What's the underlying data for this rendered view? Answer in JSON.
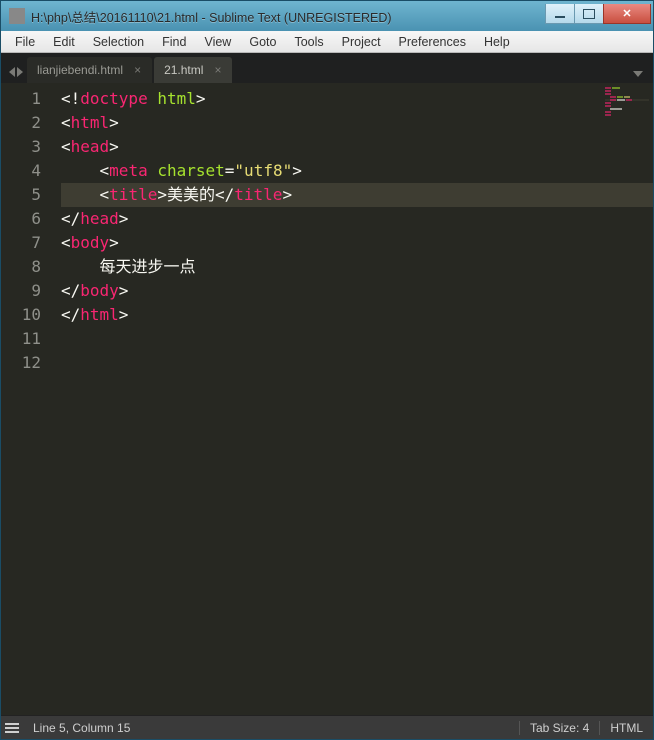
{
  "window": {
    "title": "H:\\php\\总结\\20161110\\21.html - Sublime Text (UNREGISTERED)"
  },
  "menu": {
    "items": [
      "File",
      "Edit",
      "Selection",
      "Find",
      "View",
      "Goto",
      "Tools",
      "Project",
      "Preferences",
      "Help"
    ]
  },
  "tabs": [
    {
      "label": "lianjiebendi.html",
      "active": false
    },
    {
      "label": "21.html",
      "active": true
    }
  ],
  "code": {
    "lines": [
      {
        "n": 1,
        "tokens": [
          [
            "<!",
            "punct"
          ],
          [
            "doctype",
            "tag"
          ],
          [
            " ",
            "punct"
          ],
          [
            "html",
            "attr"
          ],
          [
            ">",
            "punct"
          ]
        ]
      },
      {
        "n": 2,
        "tokens": [
          [
            "<",
            "punct"
          ],
          [
            "html",
            "tag"
          ],
          [
            ">",
            "punct"
          ]
        ]
      },
      {
        "n": 3,
        "tokens": [
          [
            "<",
            "punct"
          ],
          [
            "head",
            "tag"
          ],
          [
            ">",
            "punct"
          ]
        ]
      },
      {
        "n": 4,
        "tokens": [
          [
            "    <",
            "punct"
          ],
          [
            "meta",
            "tag"
          ],
          [
            " ",
            "punct"
          ],
          [
            "charset",
            "attr"
          ],
          [
            "=",
            "punct"
          ],
          [
            "\"utf8\"",
            "str"
          ],
          [
            ">",
            "punct"
          ]
        ]
      },
      {
        "n": 5,
        "hl": true,
        "tokens": [
          [
            "    <",
            "punct"
          ],
          [
            "title",
            "tag"
          ],
          [
            ">",
            "punct"
          ],
          [
            "美美的",
            "text"
          ],
          [
            "</",
            "punct"
          ],
          [
            "title",
            "tag"
          ],
          [
            ">",
            "punct"
          ]
        ]
      },
      {
        "n": 6,
        "tokens": [
          [
            "</",
            "punct"
          ],
          [
            "head",
            "tag"
          ],
          [
            ">",
            "punct"
          ]
        ]
      },
      {
        "n": 7,
        "tokens": [
          [
            "<",
            "punct"
          ],
          [
            "body",
            "tag"
          ],
          [
            ">",
            "punct"
          ]
        ]
      },
      {
        "n": 8,
        "tokens": [
          [
            "    每天进步一点",
            "text"
          ]
        ]
      },
      {
        "n": 9,
        "tokens": [
          [
            "</",
            "punct"
          ],
          [
            "body",
            "tag"
          ],
          [
            ">",
            "punct"
          ]
        ]
      },
      {
        "n": 10,
        "tokens": [
          [
            "</",
            "punct"
          ],
          [
            "html",
            "tag"
          ],
          [
            ">",
            "punct"
          ]
        ]
      },
      {
        "n": 11,
        "tokens": []
      },
      {
        "n": 12,
        "tokens": []
      }
    ]
  },
  "status": {
    "cursor": "Line 5, Column 15",
    "tabsize": "Tab Size: 4",
    "syntax": "HTML"
  }
}
